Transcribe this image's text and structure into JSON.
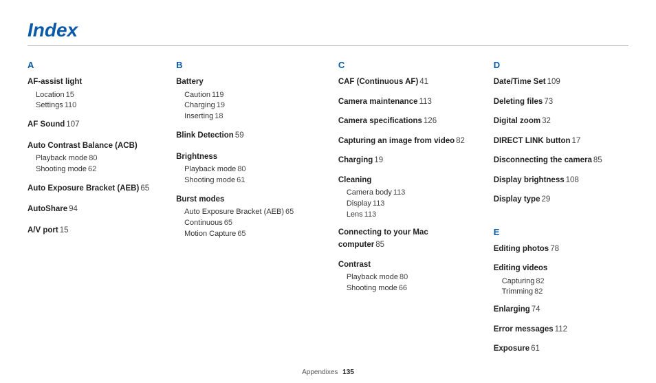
{
  "title": "Index",
  "footer": {
    "section": "Appendixes",
    "page": "135"
  },
  "colA": {
    "letter": "A",
    "groups": [
      {
        "head": {
          "t": "AF-assist light",
          "p": ""
        },
        "subs": [
          {
            "t": "Location",
            "p": "15"
          },
          {
            "t": "Settings",
            "p": "110"
          }
        ]
      },
      {
        "head": {
          "t": "AF Sound",
          "p": "107"
        },
        "subs": []
      },
      {
        "head": {
          "t": "Auto Contrast Balance (ACB)",
          "p": ""
        },
        "subs": [
          {
            "t": "Playback mode",
            "p": "80"
          },
          {
            "t": "Shooting mode",
            "p": "62"
          }
        ]
      },
      {
        "head": {
          "t": "Auto Exposure Bracket (AEB)",
          "p": "65"
        },
        "subs": []
      },
      {
        "head": {
          "t": "AutoShare",
          "p": "94"
        },
        "subs": []
      },
      {
        "head": {
          "t": "A/V port",
          "p": "15"
        },
        "subs": []
      }
    ]
  },
  "colB": {
    "letter": "B",
    "groups": [
      {
        "head": {
          "t": "Battery",
          "p": ""
        },
        "subs": [
          {
            "t": "Caution",
            "p": "119"
          },
          {
            "t": "Charging",
            "p": "19"
          },
          {
            "t": "Inserting",
            "p": "18"
          }
        ]
      },
      {
        "head": {
          "t": "Blink Detection",
          "p": "59"
        },
        "subs": []
      },
      {
        "head": {
          "t": "Brightness",
          "p": ""
        },
        "subs": [
          {
            "t": "Playback mode",
            "p": "80"
          },
          {
            "t": "Shooting mode",
            "p": "61"
          }
        ]
      },
      {
        "head": {
          "t": "Burst modes",
          "p": ""
        },
        "subs": [
          {
            "t": "Auto Exposure Bracket (AEB)",
            "p": "65"
          },
          {
            "t": "Continuous",
            "p": "65"
          },
          {
            "t": "Motion Capture",
            "p": "65"
          }
        ]
      }
    ]
  },
  "colC": {
    "letter": "C",
    "groups": [
      {
        "head": {
          "t": "CAF (Continuous AF)",
          "p": "41"
        },
        "subs": []
      },
      {
        "head": {
          "t": "Camera maintenance",
          "p": "113"
        },
        "subs": []
      },
      {
        "head": {
          "t": "Camera specifications",
          "p": "126"
        },
        "subs": []
      },
      {
        "head": {
          "t": "Capturing an image from video",
          "p": "82"
        },
        "subs": []
      },
      {
        "head": {
          "t": "Charging",
          "p": "19"
        },
        "subs": []
      },
      {
        "head": {
          "t": "Cleaning",
          "p": ""
        },
        "subs": [
          {
            "t": "Camera body",
            "p": "113"
          },
          {
            "t": "Display",
            "p": "113"
          },
          {
            "t": "Lens",
            "p": "113"
          }
        ]
      },
      {
        "head2": [
          "Connecting to your Mac",
          "computer"
        ],
        "p": "85",
        "subs": []
      },
      {
        "head": {
          "t": "Contrast",
          "p": ""
        },
        "subs": [
          {
            "t": "Playback mode",
            "p": "80"
          },
          {
            "t": "Shooting mode",
            "p": "66"
          }
        ]
      }
    ]
  },
  "colD": {
    "letter": "D",
    "groups": [
      {
        "head": {
          "t": "Date/Time Set",
          "p": "109"
        },
        "subs": []
      },
      {
        "head": {
          "t": "Deleting files",
          "p": "73"
        },
        "subs": []
      },
      {
        "head": {
          "t": "Digital zoom",
          "p": "32"
        },
        "subs": []
      },
      {
        "head": {
          "t": "DIRECT LINK button",
          "p": "17"
        },
        "subs": []
      },
      {
        "head": {
          "t": "Disconnecting the camera",
          "p": "85"
        },
        "subs": []
      },
      {
        "head": {
          "t": "Display brightness",
          "p": "108"
        },
        "subs": []
      },
      {
        "head": {
          "t": "Display type",
          "p": "29"
        },
        "subs": []
      }
    ]
  },
  "colE": {
    "letter": "E",
    "groups": [
      {
        "head": {
          "t": "Editing photos",
          "p": "78"
        },
        "subs": []
      },
      {
        "head": {
          "t": "Editing videos",
          "p": ""
        },
        "subs": [
          {
            "t": "Capturing",
            "p": "82"
          },
          {
            "t": "Trimming",
            "p": "82"
          }
        ]
      },
      {
        "head": {
          "t": "Enlarging",
          "p": "74"
        },
        "subs": []
      },
      {
        "head": {
          "t": "Error messages",
          "p": "112"
        },
        "subs": []
      },
      {
        "head": {
          "t": "Exposure",
          "p": "61"
        },
        "subs": []
      }
    ]
  }
}
